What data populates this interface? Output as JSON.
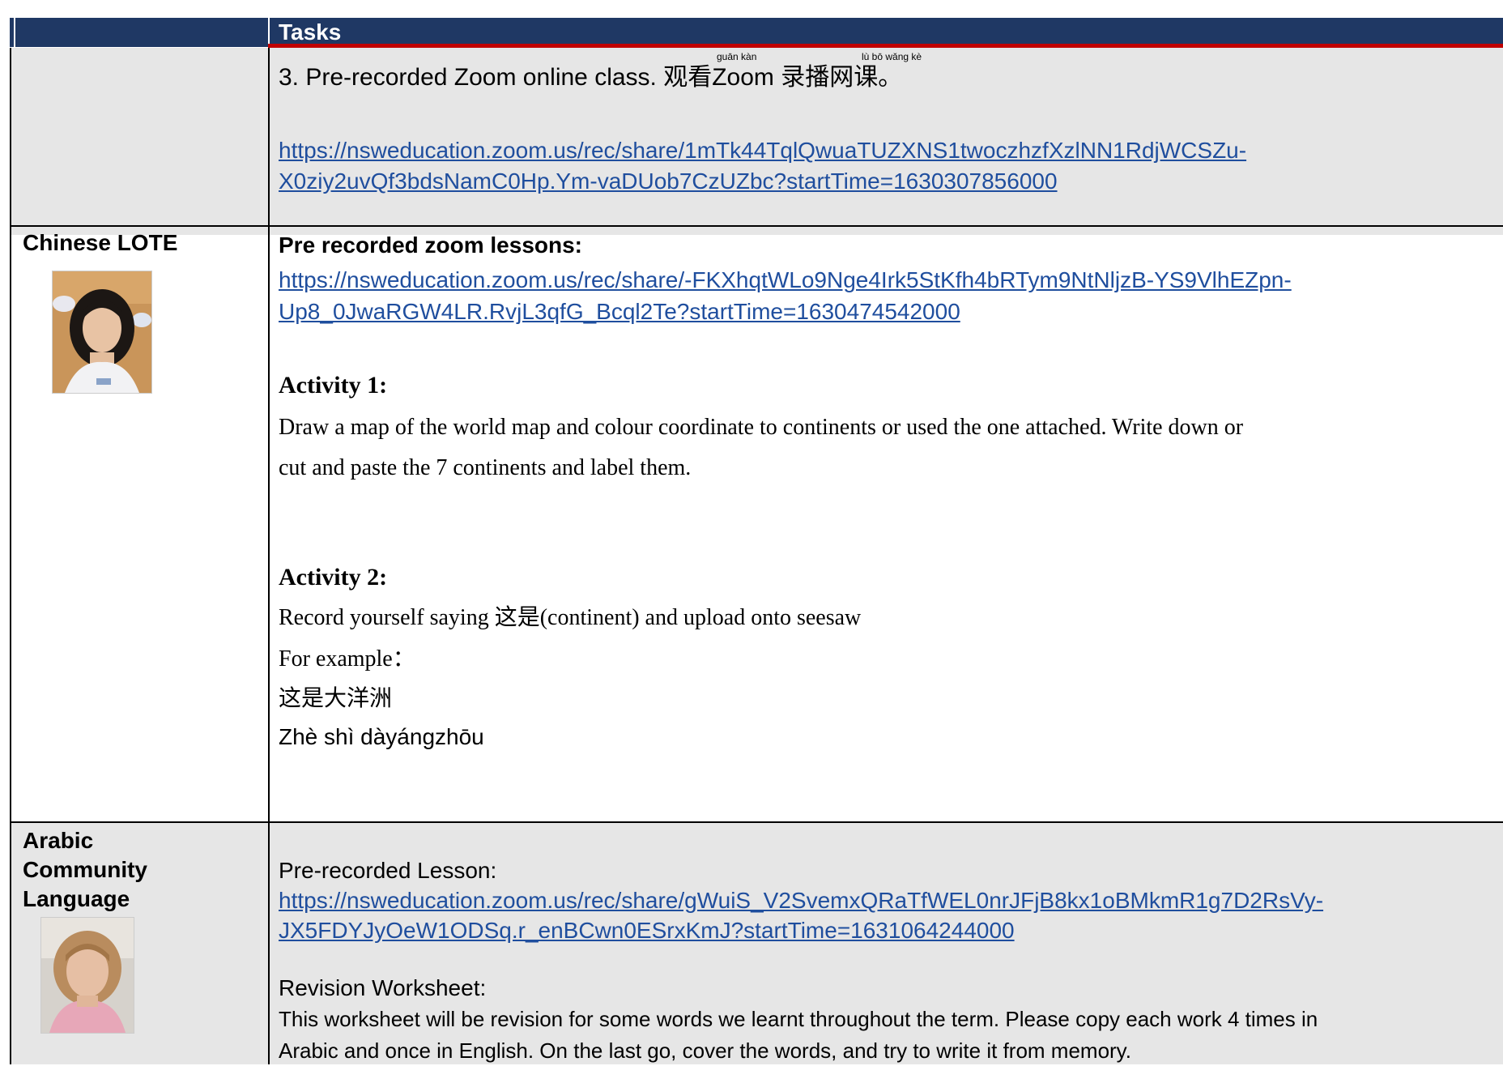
{
  "header": {
    "title": "Tasks"
  },
  "row1": {
    "zoom_line": "3. Pre-recorded Zoom online class. 观看Zoom 录播网课。",
    "ruby": {
      "guan_kan": "guān kàn",
      "lu_bo": "lù  bō wǎng kè"
    },
    "link_line1": "https://nsweducation.zoom.us/rec/share/1mTk44TqlQwuaTUZXNS1twoczhzfXzlNN1RdjWCSZu-",
    "link_line2": "X0ziy2uvQf3bdsNamC0Hp.Ym-vaDUob7CzUZbc?startTime=1630307856000"
  },
  "row2": {
    "name": "Chinese LOTE",
    "heading": "Pre recorded zoom lessons:",
    "link_line1": "https://nsweducation.zoom.us/rec/share/-FKXhqtWLo9Nge4Irk5StKfh4bRTym9NtNljzB-YS9VlhEZpn-",
    "link_line2": "Up8_0JwaRGW4LR.RvjL3qfG_Bcql2Te?startTime=1630474542000",
    "activity1_title": "Activity 1:",
    "activity1_line1": "Draw a map of the world map and colour coordinate to continents or used the one attached. Write down or",
    "activity1_line2": "cut and paste the 7 continents and label them.",
    "activity2_title": "Activity 2:",
    "activity2_line1": "Record yourself saying 这是(continent) and upload onto seesaw",
    "activity2_line2": "For example：",
    "activity2_line3": "这是大洋洲",
    "activity2_line4": "Zhè shì dàyángzhōu"
  },
  "row3": {
    "name_line1": "Arabic",
    "name_line2": "Community",
    "name_line3": "Language",
    "lesson_label": "Pre-recorded Lesson:",
    "link_line1": "https://nsweducation.zoom.us/rec/share/gWuiS_V2SvemxQRaTfWEL0nrJFjB8kx1oBMkmR1g7D2RsVy-",
    "link_line2": "JX5FDYJyOeW1ODSq.r_enBCwn0ESrxKmJ?startTime=1631064244000",
    "worksheet_label": "Revision Worksheet:",
    "worksheet_line1": "This worksheet will be revision for some words we learnt throughout the term. Please copy each work 4 times in",
    "worksheet_line2": "Arabic and once in English. On the last go, cover the words, and try to write it from memory."
  },
  "colors": {
    "header_bg": "#1f3864",
    "accent_red": "#c00000",
    "link": "#1f4e9e",
    "row_gray": "#e6e6e6"
  }
}
